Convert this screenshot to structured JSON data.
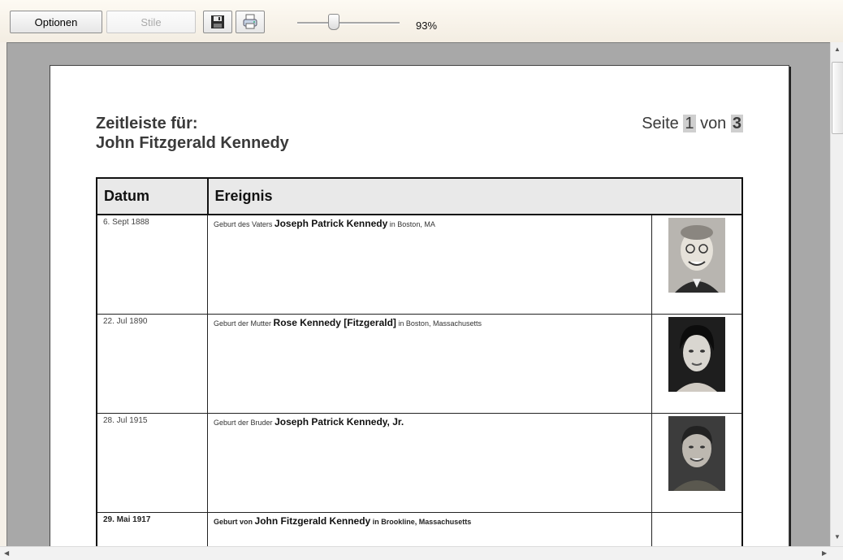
{
  "toolbar": {
    "options_label": "Optionen",
    "styles_label": "Stile",
    "save_icon": "save-icon",
    "print_icon": "print-icon",
    "zoom": "93%"
  },
  "document": {
    "title_line1": "Zeitleiste für:",
    "title_line2": "John Fitzgerald Kennedy",
    "page_label": "Seite",
    "page_current": "1",
    "page_of": "von",
    "page_total": "3",
    "columns": {
      "date": "Datum",
      "event": "Ereignis"
    },
    "rows": [
      {
        "date": "6. Sept 1888",
        "prefix": "Geburt des Vaters",
        "name": "Joseph Patrick Kennedy",
        "suffix": "in Boston, MA",
        "photo": "father-photo"
      },
      {
        "date": "22. Jul 1890",
        "prefix": "Geburt der Mutter",
        "name": "Rose Kennedy [Fitzgerald]",
        "suffix": "in Boston, Massachusetts",
        "photo": "mother-photo"
      },
      {
        "date": "28. Jul 1915",
        "prefix": "Geburt der Bruder",
        "name": "Joseph Patrick Kennedy, Jr.",
        "suffix": "",
        "photo": "brother-photo"
      },
      {
        "date": "29. Mai 1917",
        "prefix": "Geburt von",
        "name": "John Fitzgerald Kennedy",
        "suffix": "in Brookline, Massachusetts",
        "photo": ""
      }
    ]
  }
}
